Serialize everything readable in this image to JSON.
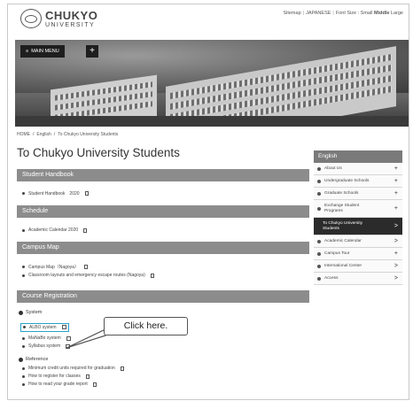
{
  "header": {
    "logo_main": "CHUKYO",
    "logo_sub": "UNIVERSITY",
    "util_sitemap": "Sitemap",
    "util_japanese": "JAPANESE",
    "util_font_label": "Font Size :",
    "util_small": "Small",
    "util_middle": "Middle",
    "util_large": "Large"
  },
  "hero": {
    "menu_label": "MAIN MENU",
    "plus": "+"
  },
  "breadcrumb": {
    "home": "HOME",
    "english": "English",
    "current": "To Chukyo University Students",
    "sep": "/"
  },
  "page_title": "To Chukyo University Students",
  "sections": {
    "handbook": {
      "title": "Student Handbook",
      "items": [
        "Student Handbook　2020"
      ]
    },
    "schedule": {
      "title": "Schedule",
      "items": [
        "Academic Calendar 2020"
      ]
    },
    "campus_map": {
      "title": "Campus Map",
      "items": [
        "Campus Map（Nagoya）",
        "Classroom layouts and emergency escape routes (Nagoya)"
      ]
    },
    "registration": {
      "title": "Course Registration",
      "system_head": "System",
      "system_items": [
        "ALBO system",
        "MaNaBo system",
        "Syllabus system"
      ],
      "reference_head": "Reference",
      "reference_items": [
        "Minimum credit units required for graduation",
        "How to register for classes",
        "How to read your grade report"
      ]
    }
  },
  "callout": {
    "text": "Click here."
  },
  "sidebar": {
    "title": "English",
    "items": [
      {
        "label": "About Us",
        "mark": "+"
      },
      {
        "label": "Undergraduate Schools",
        "mark": "+"
      },
      {
        "label": "Graduate Schools",
        "mark": "+"
      },
      {
        "label": "Exchange Student Programs",
        "mark": "+"
      },
      {
        "label": "To Chukyo University Students",
        "mark": ">"
      },
      {
        "label": "Academic Calendar",
        "mark": ">"
      },
      {
        "label": "Campus Tour",
        "mark": "+"
      },
      {
        "label": "International Center",
        "mark": ">"
      },
      {
        "label": "Access",
        "mark": ">"
      }
    ]
  },
  "colors": {
    "highlight_border": "#2aa0c9",
    "section_bar": "#8c8c8c",
    "sidebar_active": "#2b2b2b"
  }
}
